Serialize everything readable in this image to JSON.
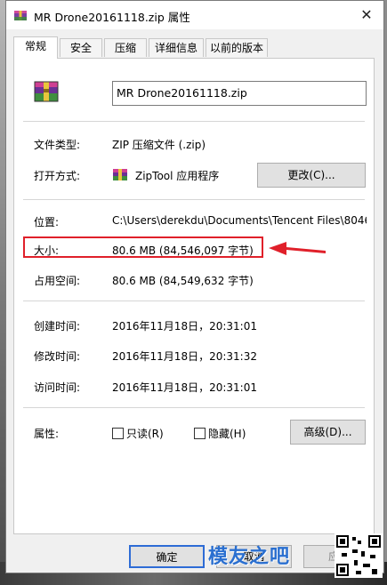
{
  "window": {
    "title": "MR Drone20161118.zip 属性",
    "close_glyph": "✕"
  },
  "tabs": [
    {
      "label": "常规",
      "active": true
    },
    {
      "label": "安全",
      "active": false
    },
    {
      "label": "压缩",
      "active": false
    },
    {
      "label": "详细信息",
      "active": false
    },
    {
      "label": "以前的版本",
      "active": false
    }
  ],
  "general": {
    "file_name": "MR Drone20161118.zip",
    "file_type_label": "文件类型:",
    "file_type_value": "ZIP 压缩文件 (.zip)",
    "opens_with_label": "打开方式:",
    "opens_with_value": "ZipTool 应用程序",
    "change_button": "更改(C)...",
    "location_label": "位置:",
    "location_value": "C:\\Users\\derekdu\\Documents\\Tencent Files\\8046",
    "size_label": "大小:",
    "size_value": "80.6 MB (84,546,097 字节)",
    "size_on_disk_label": "占用空间:",
    "size_on_disk_value": "80.6 MB (84,549,632 字节)",
    "created_label": "创建时间:",
    "created_value": "2016年11月18日，20:31:01",
    "modified_label": "修改时间:",
    "modified_value": "2016年11月18日，20:31:32",
    "accessed_label": "访问时间:",
    "accessed_value": "2016年11月18日，20:31:01",
    "attributes_label": "属性:",
    "readonly_label": "只读(R)",
    "hidden_label": "隐藏(H)",
    "advanced_button": "高级(D)..."
  },
  "footer": {
    "ok_button": "确定",
    "cancel_button": "取消",
    "apply_button": "应用"
  },
  "watermark": {
    "text": "模友之吧"
  },
  "colors": {
    "highlight": "#e0202a",
    "default_button_border": "#2e6cd6"
  }
}
